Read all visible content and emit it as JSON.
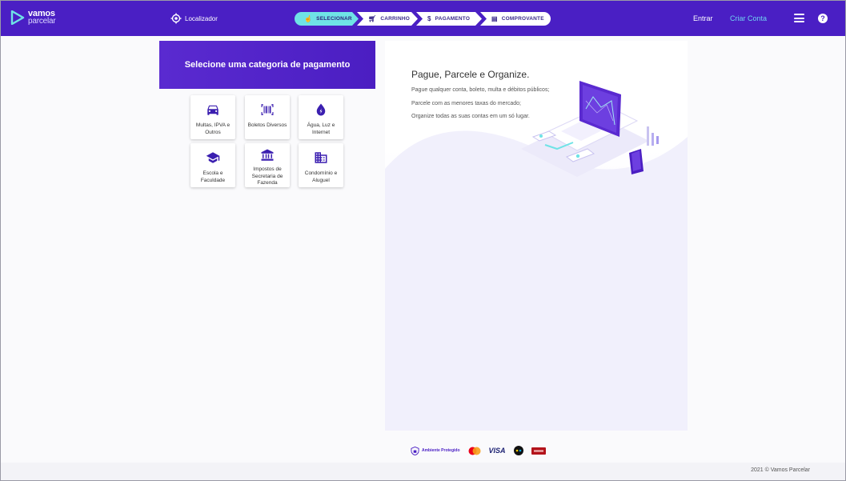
{
  "header": {
    "logo_line1": "vamos",
    "logo_line2": "parcelar",
    "locator_label": "Localizador",
    "steps": [
      {
        "label": "SELECIONAR",
        "active": true,
        "icon": "touch-icon"
      },
      {
        "label": "CARRINHO",
        "active": false,
        "icon": "cart-icon"
      },
      {
        "label": "PAGAMENTO",
        "active": false,
        "icon": "dollar-icon"
      },
      {
        "label": "COMPROVANTE",
        "active": false,
        "icon": "receipt-icon"
      }
    ],
    "login_label": "Entrar",
    "signup_label": "Criar Conta",
    "help_label": "?"
  },
  "categories": {
    "title": "Selecione uma categoria de pagamento",
    "items": [
      {
        "label": "Multas, IPVA e Outros",
        "icon": "car-icon"
      },
      {
        "label": "Boletos Diversos",
        "icon": "barcode-icon"
      },
      {
        "label": "Água, Luz e Internet",
        "icon": "water-drop-icon"
      },
      {
        "label": "Escola e Faculdade",
        "icon": "graduation-cap-icon"
      },
      {
        "label": "Impostos de Secretaria de Fazenda",
        "icon": "bank-icon"
      },
      {
        "label": "Condomínio e Aluguel",
        "icon": "building-icon"
      }
    ]
  },
  "promo": {
    "headline": "Pague, Parcele e Organize.",
    "lines": [
      "Pague qualquer conta, boleto, multa e débitos públicos;",
      "Parcele com as menores taxas do mercado;",
      "Organize todas as suas contas em um só lugar."
    ]
  },
  "footer": {
    "secure_label": "Ambiente Protegido",
    "card_brands": [
      "mastercard",
      "VISA",
      "elo",
      "hipercard"
    ],
    "copyright": "2021 © Vamos Parcelar"
  },
  "colors": {
    "brand": "#4a1fc4",
    "accent": "#6fe3e6",
    "link": "#6fd4f2"
  }
}
